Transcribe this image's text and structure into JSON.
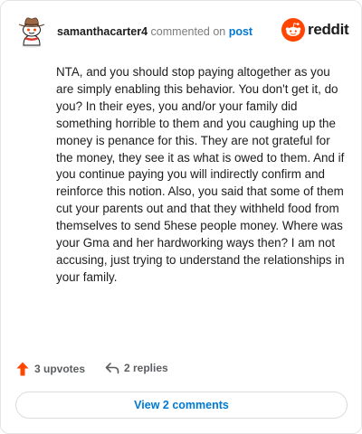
{
  "header": {
    "username": "samanthacarter4",
    "action_text": " commented on ",
    "post_link": "post",
    "brand_name": "reddit",
    "brand_color": "#ff4500"
  },
  "comment": {
    "body": "NTA, and you should stop paying altogether as you are simply enabling this behavior. You don't get it, do you? In their eyes, you and/or your family did something horrible to them and you caughing up the money is penance for this. They are not grateful for the money, they see it as what is owed to them. And if you continue paying you will indirectly confirm and reinforce this notion. Also, you said that some of them cut your parents out and that they withheld food from themselves to send 5hese people money. Where was your Gma and her hardworking ways then? I am not accusing, just trying to understand the relationships in your family."
  },
  "actions": {
    "upvote_icon": "upvote-arrow-icon",
    "upvote_label": "3 upvotes",
    "upvote_color": "#ff4500",
    "reply_icon": "reply-arrow-icon",
    "replies_label": "2 replies"
  },
  "footer": {
    "view_comments_label": "View 2 comments",
    "link_color": "#0079d3"
  }
}
